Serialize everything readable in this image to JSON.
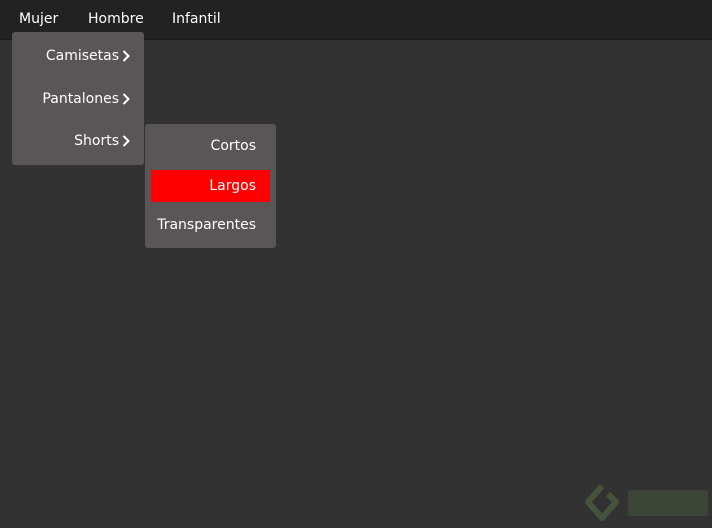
{
  "nav": {
    "items": [
      {
        "label": "Mujer"
      },
      {
        "label": "Hombre"
      },
      {
        "label": "Infantil"
      }
    ]
  },
  "submenu": {
    "items": [
      {
        "label": "Camisetas",
        "icon": "chevron-right-icon"
      },
      {
        "label": "Pantalones",
        "icon": "chevron-right-icon"
      },
      {
        "label": "Shorts",
        "icon": "chevron-right-icon"
      }
    ]
  },
  "shorts_menu": {
    "items": [
      {
        "label": "Cortos"
      },
      {
        "label": "Largos",
        "highlighted": true
      },
      {
        "label": "Transparentes"
      }
    ]
  },
  "colors": {
    "page_background": "#323232",
    "topbar_background": "#222222",
    "menu_background": "#5a5657",
    "highlight": "#ff0000",
    "text": "#ffffff"
  },
  "watermark": {
    "icon": "platzi-logo-icon"
  }
}
